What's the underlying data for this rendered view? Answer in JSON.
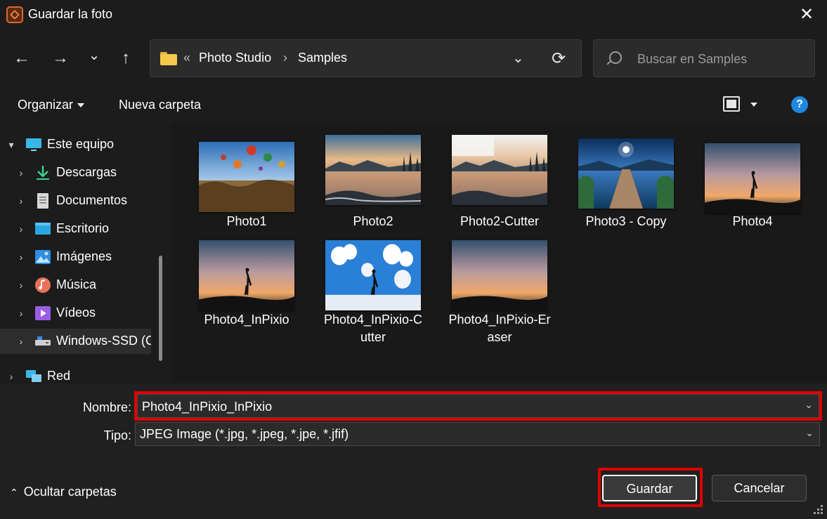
{
  "window": {
    "title": "Guardar la foto",
    "close_glyph": "✕"
  },
  "nav": {
    "back": "←",
    "forward": "→",
    "recent": "⌄",
    "up": "↑",
    "breadcrumb": {
      "overflow": "«",
      "sep": "›",
      "items": [
        "Photo Studio",
        "Samples"
      ]
    },
    "dropdown": "⌄",
    "refresh": "⟳"
  },
  "search": {
    "placeholder": "Buscar en Samples",
    "value": ""
  },
  "toolbar": {
    "organize": "Organizar",
    "new_folder": "Nueva carpeta",
    "help": "?"
  },
  "sidebar": {
    "items": [
      {
        "label": "Este equipo",
        "icon": "computer-icon",
        "expanded": true
      },
      {
        "label": "Descargas",
        "icon": "download-icon"
      },
      {
        "label": "Documentos",
        "icon": "document-icon"
      },
      {
        "label": "Escritorio",
        "icon": "desktop-icon"
      },
      {
        "label": "Imágenes",
        "icon": "pictures-icon"
      },
      {
        "label": "Música",
        "icon": "music-icon"
      },
      {
        "label": "Vídeos",
        "icon": "videos-icon"
      },
      {
        "label": "Windows-SSD (C",
        "icon": "drive-icon",
        "selected": true
      },
      {
        "label": "Red",
        "icon": "network-icon"
      }
    ]
  },
  "files": [
    {
      "name": "Photo1",
      "scene": "balloons"
    },
    {
      "name": "Photo2",
      "scene": "lake"
    },
    {
      "name": "Photo2-Cutter",
      "scene": "lake-cut"
    },
    {
      "name": "Photo3 - Copy",
      "scene": "pier"
    },
    {
      "name": "Photo4",
      "scene": "sunset"
    },
    {
      "name": "Photo4_InPixio",
      "scene": "sunset"
    },
    {
      "name": "Photo4_InPixio-C\nutter",
      "scene": "blue-sky"
    },
    {
      "name": "Photo4_InPixio-Er\naser",
      "scene": "sunset2"
    }
  ],
  "form": {
    "name_label": "Nombre:",
    "name_value": "Photo4_InPixio_InPixio",
    "type_label": "Tipo:",
    "type_value": "JPEG Image (*.jpg, *.jpeg, *.jpe, *.jfif)",
    "highlight_color": "#e00000"
  },
  "footer": {
    "hide_folders": "Ocultar carpetas",
    "save": "Guardar",
    "cancel": "Cancelar"
  }
}
